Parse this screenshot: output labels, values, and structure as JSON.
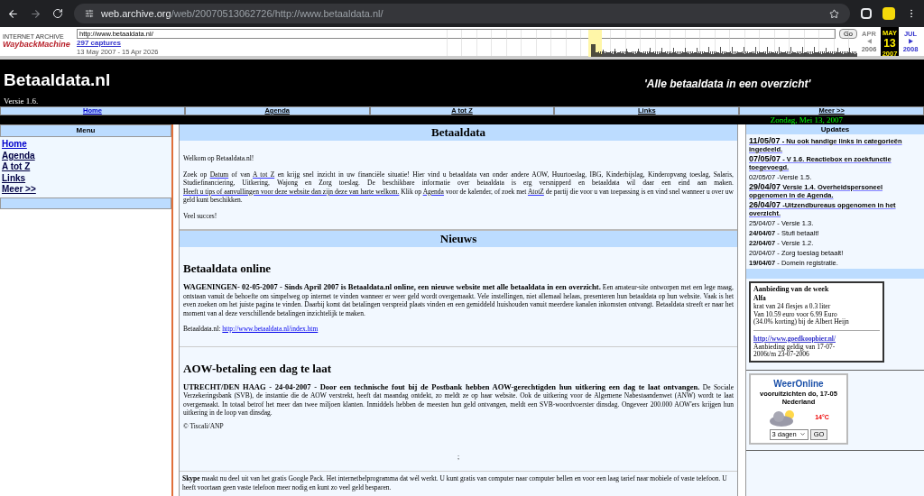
{
  "browser": {
    "url_host": "web.archive.org",
    "url_path": "/web/20070513062726/http://www.betaaldata.nl/"
  },
  "wayback": {
    "logo_top": "INTERNET ARCHIVE",
    "logo": "WaybackMachine",
    "url": "http://www.betaaldata.nl/",
    "go": "Go",
    "captures": "297 captures",
    "range": "13 May 2007 - 15 Apr 2026",
    "prev": {
      "month": "APR",
      "year": "2006"
    },
    "current": {
      "month": "MAY",
      "day": "13",
      "year": "2007"
    },
    "next": {
      "month": "JUL",
      "year": "2008"
    }
  },
  "header": {
    "title": "Betaaldata.nl",
    "tagline": "'Alle betaaldata in een overzicht'",
    "version": "Versie 1.6."
  },
  "nav": [
    {
      "label": "Home",
      "selected": true
    },
    {
      "label": "Agenda",
      "selected": false
    },
    {
      "label": "A tot Z",
      "selected": false
    },
    {
      "label": "Links",
      "selected": false
    },
    {
      "label": "Meer >>",
      "selected": false
    }
  ],
  "date": "Zondag, Mei 13, 2007",
  "menu": {
    "title": "Menu",
    "items": [
      {
        "label": "Home",
        "selected": true
      },
      {
        "label": "Agenda",
        "selected": false
      },
      {
        "label": "A tot Z",
        "selected": false
      },
      {
        "label": "Links",
        "selected": false
      },
      {
        "label": "Meer >>",
        "selected": false
      }
    ]
  },
  "intro": {
    "title": "Betaaldata",
    "welcome": "Welkom op Betaaldata.nl!",
    "paragraph": [
      {
        "kind": "text",
        "text": "Zoek op"
      },
      {
        "kind": "link",
        "text": "Datum"
      },
      {
        "kind": "text",
        "text": "of van"
      },
      {
        "kind": "link",
        "text": "A tot Z"
      },
      {
        "kind": "text",
        "text": "en krijg snel inzicht in uw financiële situatie! Hier vind u betaaldata van onder andere AOW, Huurtoeslag, IBG, Kinderbijslag, Kinderopvang toeslag, Salaris, Studiefinanciering, Uitkering, Wajong en Zorg toeslag. De beschikbare informatie over betaaldata is erg versnipperd en betaaldata wil daar een eind aan maken."
      },
      {
        "kind": "link",
        "text": "Heeft u tips of aanvullingen voor deze website dan zijn deze van harte welkom."
      },
      {
        "kind": "text",
        "text": "Klik op"
      },
      {
        "kind": "link",
        "text": "Agenda"
      },
      {
        "kind": "text",
        "text": "voor de kalender, of zoek met"
      },
      {
        "kind": "link",
        "text": "AtotZ"
      },
      {
        "kind": "text",
        "text": "de partij die voor u van toepassing is en vind snel wanneer u over uw geld kunt beschikken."
      }
    ],
    "closing": "Veel succes!"
  },
  "news": {
    "title": "Nieuws",
    "articles": [
      {
        "headline": "Betaaldata online",
        "lead": "WAGENINGEN- 02-05-2007 - Sinds April 2007 is Betaaldata.nl online, een nieuwe website met alle betaaldata in een overzicht.",
        "body": "Een amateur-site ontworpen met een lege maag, ontstaan vanuit de behoefte om simpelweg op internet te vinden wanneer er weer geld wordt overgemaakt. Vele instellingen, niet allemaal helaas, presenteren hun betaaldata op hun website. Vaak is het even zoeken om het juiste pagina te vinden. Daarbij komt dat betalingen verspreid plaats vinden en een gemiddeld huishouden vanuit meerdere kanalen inkomsten ontvangt. Betaaldata streeft er naar het moment van al deze verschillende betalingen inzichtelijk te maken.",
        "source_label": "Betaaldata.nl:",
        "source_link": "http://www.betaaldata.nl/index.htm"
      },
      {
        "headline": "AOW-betaling een dag te laat",
        "lead": "UTRECHT/DEN HAAG - 24-04-2007 - Door een technische fout bij de Postbank hebben AOW-gerechtigden hun uitkering een dag te laat ontvangen.",
        "body": "De Sociale Verzekeringsbank (SVB), de instantie die de AOW verstrekt, heeft dat maandag ontdekt, zo meldt ze op haar website. Ook de uitkering voor de Algemene Nabestaandenwet (ANW) wordt te laat overgemaakt. In totaal betrof het meer dan twee miljoen klanten. Inmiddels hebben de meesten hun geld ontvangen, meldt een SVB-woordvoerster dinsdag. Ongeveer 200.000 AOW'ers krijgen hun uitkering in de loop van dinsdag.",
        "credit": "© Tiscali/ANP"
      }
    ],
    "separator": ";"
  },
  "skype": "**Skype** maakt nu deel uit van het gratis Google Pack. Het internetbelprogramma dat wél werkt. U kunt gratis van computer naar computer bellen en voor een laag tarief naar mobiele of vaste telefoon. U heeft voortaan geen vaste telefoon meer nodig en kunt zo veel geld besparen.",
  "updates": {
    "title": "Updates",
    "items": [
      {
        "kind": "highlight",
        "date": "11/05/07",
        "text": "- Nu ook handige links in categorieën ingedeeld."
      },
      {
        "kind": "highlight",
        "date": "07/05/07",
        "text": "- V 1.6. Reactiebox en zoekfunctie toegevoegd."
      },
      {
        "kind": "plain",
        "date": "02/05/07",
        "text": "-Versie 1.5."
      },
      {
        "kind": "highlight",
        "date": "29/04/07",
        "text": "Versie 1.4. Overheidspersoneel opgenomen in de Agenda."
      },
      {
        "kind": "highlight",
        "date": "26/04/07",
        "text": "-Uitzendbureaus opgenomen in het overzicht."
      },
      {
        "kind": "plain",
        "date": "25/04/07",
        "text": "- Versie 1.3."
      },
      {
        "kind": "bold",
        "date": "24/04/07",
        "text": "- Stufi betaalt!"
      },
      {
        "kind": "bold",
        "date": "22/04/07",
        "text": "- Versie 1.2."
      },
      {
        "kind": "plain",
        "date": "20/04/07",
        "text": "- Zorg toeslag betaalt!"
      },
      {
        "kind": "bold",
        "date": "19/04/07",
        "text": "- Domein registratie."
      }
    ]
  },
  "offer": {
    "title": "Aanbieding van de week",
    "product": "Alfa",
    "details": [
      "krat van 24 flesjes a 0.3 liter",
      "Van 10.59 euro voor 6.99 Euro",
      "(34.0% korting) bij de Albert Heijn"
    ],
    "link": "http://www.goedkoopbier.nl/",
    "validity": "Aanbieding geldig van 17-07-2006t/m 23-07-2006"
  },
  "weather": {
    "logo": "WeerOnline",
    "forecast": "vooruitzichten do, 17-05",
    "region": "Nederland",
    "temperature": "14°C",
    "select": "3 dagen",
    "go": "GO"
  }
}
